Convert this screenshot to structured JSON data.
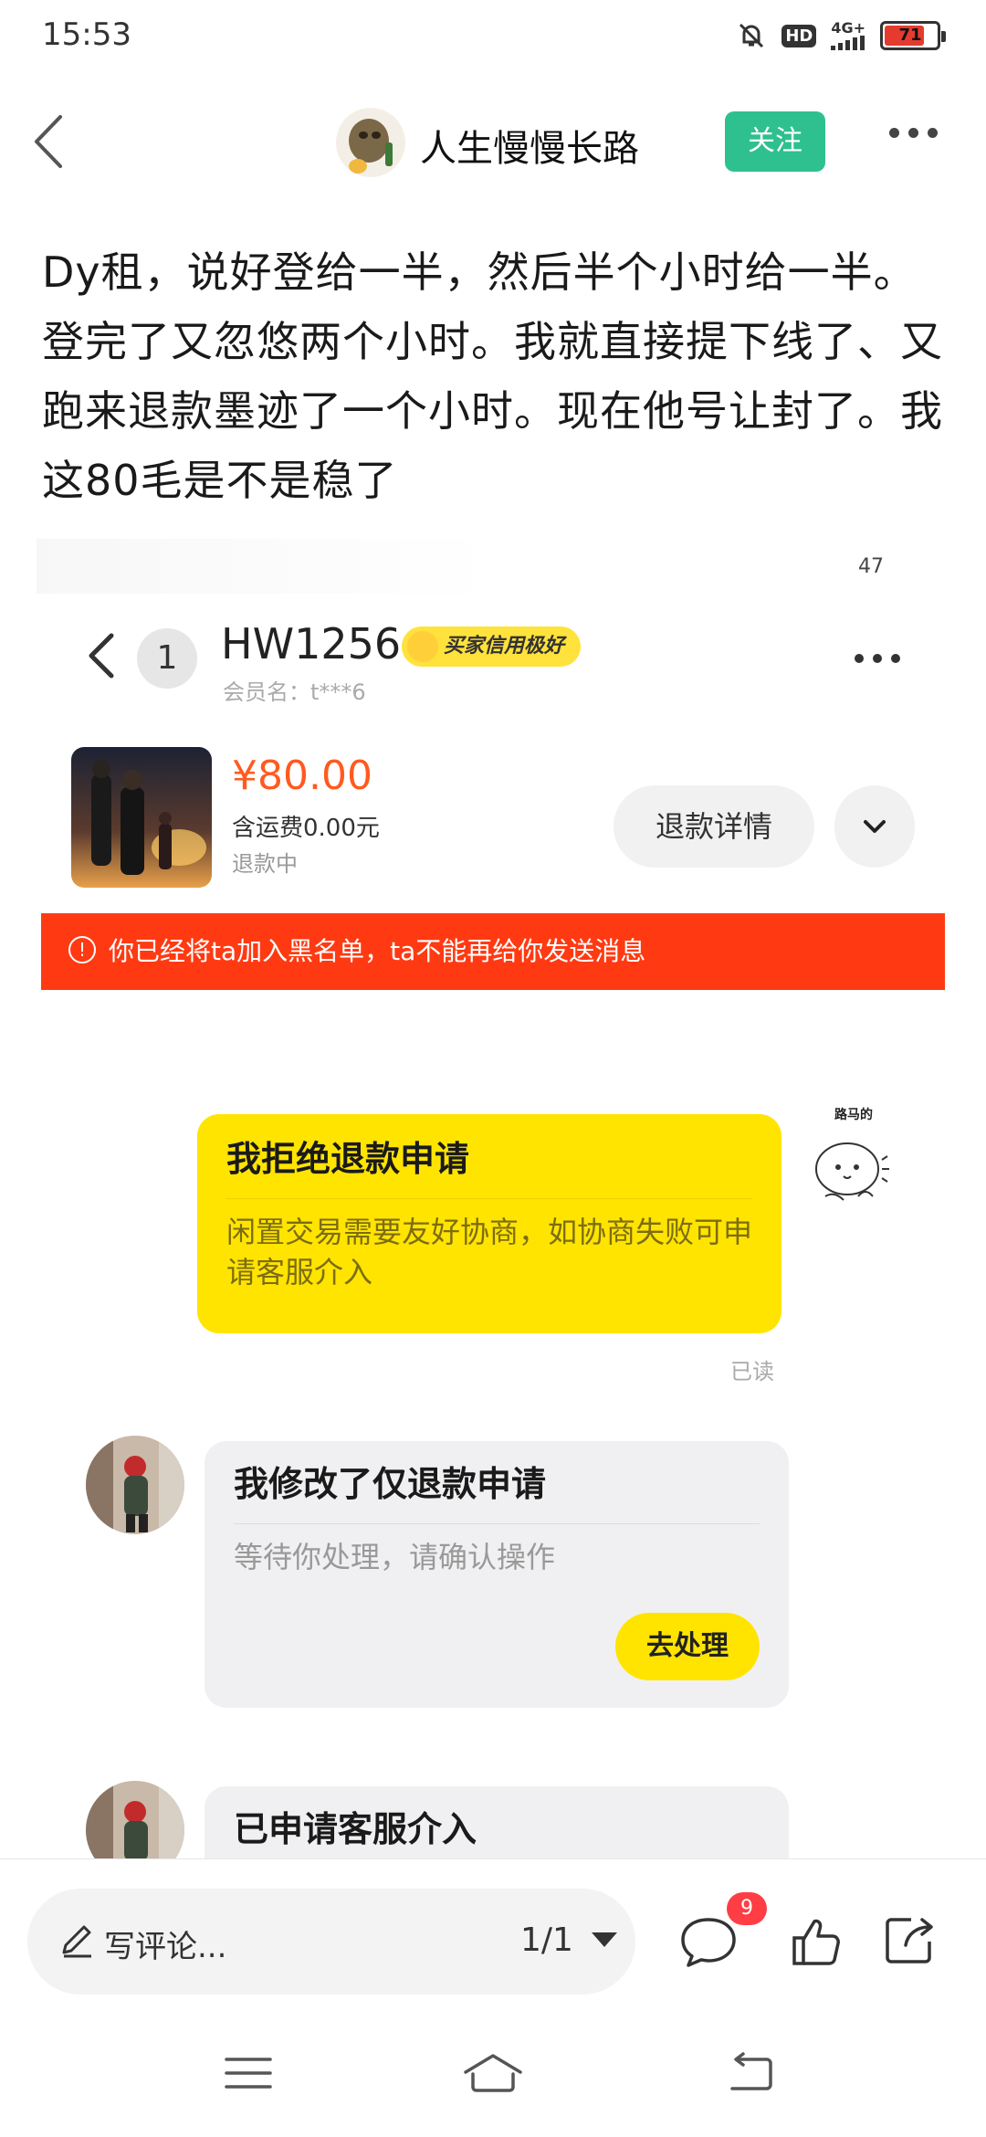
{
  "status_bar": {
    "time": "15:53",
    "hd": "HD",
    "network": "4G+",
    "battery": "71",
    "battery_level": 0.71
  },
  "post": {
    "author": "人生慢慢长路",
    "follow_label": "关注",
    "body": "Dy租，说好登给一半，然后半个小时给一半。登完了又忽悠两个小时。我就直接提下线了、又跑来退款墨迹了一个小时。现在他号让封了。我这80毛是不是稳了"
  },
  "screenshot": {
    "image_number": "47",
    "chat": {
      "unread_count": "1",
      "username": "HW1256",
      "credit_badge": "买家信用极好",
      "member_name": "会员名：t***6"
    },
    "order": {
      "price": "¥80.00",
      "shipping": "含运费0.00元",
      "status": "退款中",
      "refund_detail_label": "退款详情"
    },
    "blacklist_notice": "你已经将ta加入黑名单，ta不能再给你发送消息",
    "messages": [
      {
        "title": "我拒绝退款申请",
        "subtitle": "闲置交易需要友好协商，如协商失败可申请客服介入",
        "read": "已读"
      },
      {
        "title": "我修改了仅退款申请",
        "subtitle": "等待你处理，请确认操作",
        "action": "去处理"
      },
      {
        "title": "已申请客服介入"
      }
    ],
    "sticker_text": "路马的"
  },
  "bottom_bar": {
    "comment_placeholder": "写评论...",
    "page_indicator": "1/1",
    "comment_count": "9"
  },
  "colors": {
    "follow_green": "#2fc08f",
    "price_orange": "#ff5a1f",
    "banner_red": "#ff3a12",
    "bubble_yellow": "#ffe400",
    "badge_red": "#ff3d44"
  }
}
